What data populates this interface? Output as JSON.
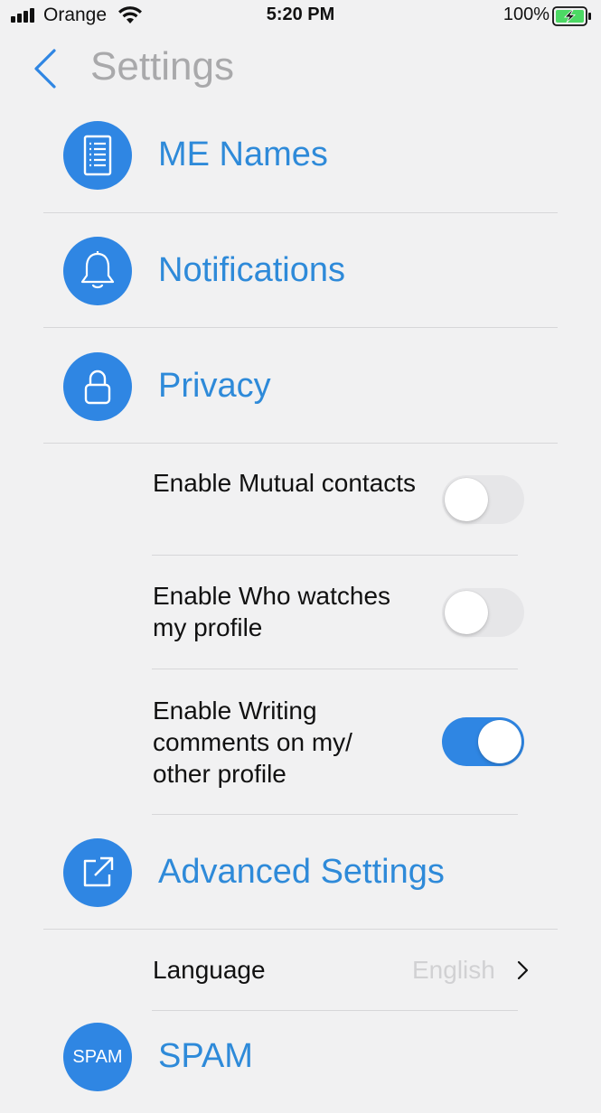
{
  "status_bar": {
    "carrier": "Orange",
    "time": "5:20 PM",
    "battery": "100%"
  },
  "nav": {
    "title": "Settings"
  },
  "colors": {
    "accent": "#2f86e3",
    "title_blue": "#2e8ad9",
    "background": "#f1f1f2"
  },
  "sections": {
    "me_names": {
      "label": "ME Names",
      "icon": "list-icon"
    },
    "notifications": {
      "label": "Notifications",
      "icon": "bell-icon"
    },
    "privacy": {
      "label": "Privacy",
      "icon": "lock-icon"
    },
    "advanced": {
      "label": "Advanced Settings",
      "icon": "external-link-icon"
    },
    "spam": {
      "label": "SPAM",
      "icon_text": "SPAM"
    }
  },
  "privacy_options": [
    {
      "label": "Enable Mutual contacts",
      "enabled": false
    },
    {
      "label": "Enable Who watches my profile",
      "enabled": false
    },
    {
      "label": "Enable Writing comments on my/ other profile",
      "enabled": true
    }
  ],
  "advanced_options": {
    "language_label": "Language",
    "language_value": "English"
  }
}
